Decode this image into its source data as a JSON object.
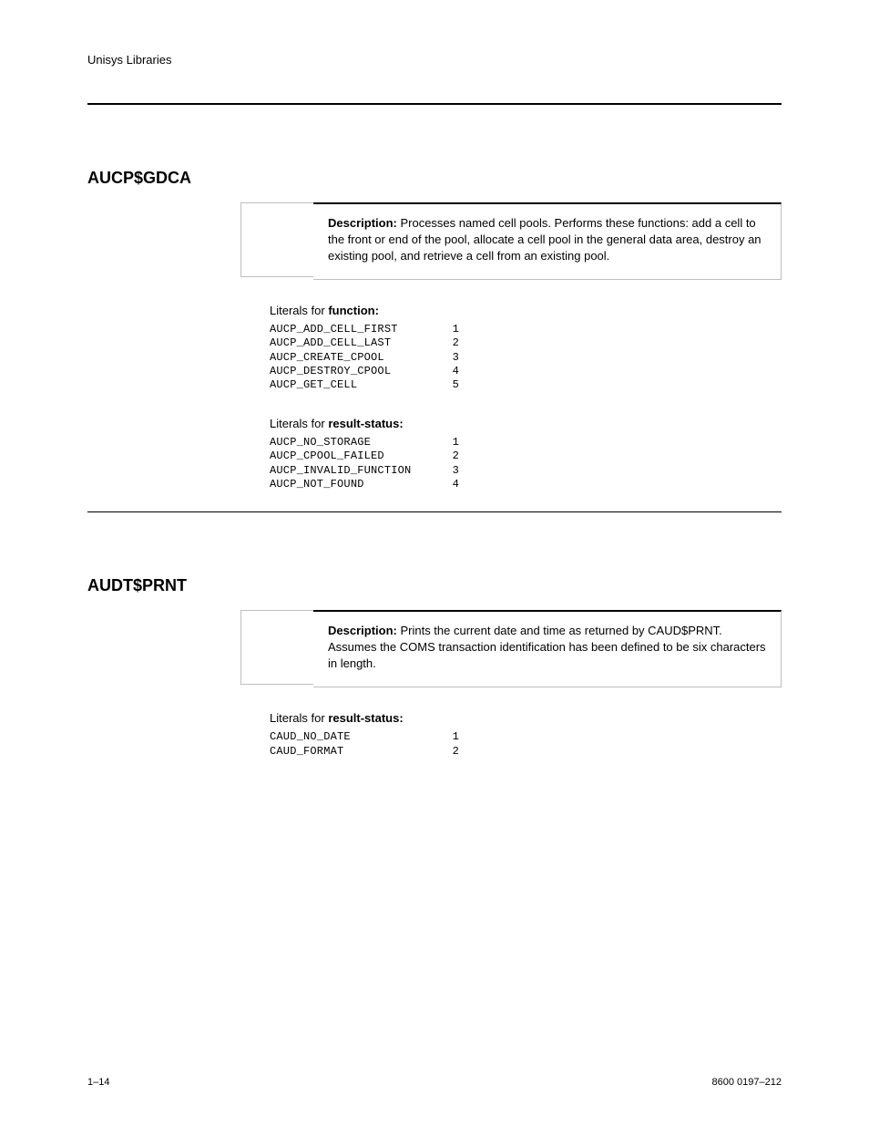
{
  "header": {
    "title": "Unisys Libraries"
  },
  "sections": [
    {
      "title": "AUCP$GDCA",
      "desc_lead": "Description: ",
      "desc_text": "Processes named cell pools. Performs these functions: add a cell to the front or end of the pool, allocate a cell pool in the general data area, destroy an existing pool, and retrieve a cell from an existing pool.",
      "groups": [
        {
          "heading_label": "Literals for ",
          "heading_key": "function:",
          "rows": [
            {
              "k": "AUCP_ADD_CELL_FIRST",
              "v": "1"
            },
            {
              "k": "AUCP_ADD_CELL_LAST",
              "v": "2"
            },
            {
              "k": "AUCP_CREATE_CPOOL",
              "v": "3"
            },
            {
              "k": "AUCP_DESTROY_CPOOL",
              "v": "4"
            },
            {
              "k": "AUCP_GET_CELL",
              "v": "5"
            }
          ]
        },
        {
          "heading_label": "Literals for ",
          "heading_key": "result-status:",
          "rows": [
            {
              "k": "AUCP_NO_STORAGE",
              "v": "1"
            },
            {
              "k": "AUCP_CPOOL_FAILED",
              "v": "2"
            },
            {
              "k": "AUCP_INVALID_FUNCTION",
              "v": "3"
            },
            {
              "k": "AUCP_NOT_FOUND",
              "v": "4"
            }
          ]
        }
      ]
    },
    {
      "title": "AUDT$PRNT",
      "desc_lead": "Description: ",
      "desc_text": "Prints the current date and time as returned by CAUD$PRNT. Assumes the COMS transaction identification has been defined to be six characters in length.",
      "groups": [
        {
          "heading_label": "Literals for ",
          "heading_key": "result-status:",
          "rows": [
            {
              "k": "CAUD_NO_DATE",
              "v": "1"
            },
            {
              "k": "CAUD_FORMAT",
              "v": "2"
            }
          ]
        }
      ]
    }
  ],
  "footer": {
    "left": "1–14",
    "right": "8600 0197–212"
  }
}
